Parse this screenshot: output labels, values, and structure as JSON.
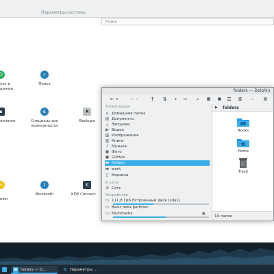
{
  "settings": {
    "title": "Параметры системы",
    "search_placeholder": "Поиск",
    "modules": [
      {
        "label": "уск и\nшение",
        "icon": "power-icon",
        "color": "#27ae60"
      },
      {
        "label": "Поиск",
        "icon": "search-icon",
        "color": "#2980b9"
      },
      {
        "label": "ожения",
        "icon": "applications-icon",
        "color": "#2c3e50"
      },
      {
        "label": "Специальные\nвозможности",
        "icon": "accessibility-icon",
        "color": "#2980b9"
      },
      {
        "label": "Backups",
        "icon": "backups-icon",
        "color": "#7f8c8d"
      },
      {
        "label": "\nием",
        "icon": "power-management-icon",
        "color": "#f1c40f"
      },
      {
        "label": "Bluetooth",
        "icon": "bluetooth-icon",
        "color": "#2980b9"
      },
      {
        "label": "KDE Connect",
        "icon": "kde-connect-icon",
        "color": "#2c3e50"
      }
    ]
  },
  "dolphin": {
    "title": "folders — Dolphin",
    "sections": {
      "places": "Точки входа",
      "network": "В сети",
      "devices": "Устройства"
    },
    "places": [
      {
        "label": "Домашняя папка",
        "icon": "home-icon"
      },
      {
        "label": "Документы",
        "icon": "documents-icon"
      },
      {
        "label": "Загрузки",
        "icon": "downloads-icon"
      },
      {
        "label": "Видео",
        "icon": "video-icon"
      },
      {
        "label": "Изображения",
        "icon": "pictures-icon"
      },
      {
        "label": "Книги",
        "icon": "books-icon"
      },
      {
        "label": "Музыка",
        "icon": "music-icon"
      },
      {
        "label": "Фото",
        "icon": "photo-icon"
      },
      {
        "label": "GitHub",
        "icon": "github-icon"
      },
      {
        "label": "folders",
        "icon": "folder-icon",
        "selected": true
      },
      {
        "label": "work",
        "icon": "folder-icon"
      },
      {
        "label": "Корзина",
        "icon": "trash-icon"
      }
    ],
    "network": [
      {
        "label": "Сеть",
        "icon": "network-icon"
      }
    ],
    "devices": [
      {
        "label": "111,8 ГиБ Встроенный диск (sda1)",
        "icon": "disk-icon",
        "usage": 0.42
      },
      {
        "label": "Basic data partition",
        "icon": "disk-icon"
      },
      {
        "label": "Multimedia",
        "icon": "disk-icon",
        "usage": 0.55
      }
    ],
    "breadcrumb": "folders",
    "items": [
      {
        "label": "Books",
        "icon": "folder-books-icon"
      },
      {
        "label": "Home",
        "icon": "folder-home-icon"
      },
      {
        "label": "Trash",
        "icon": "trash-full-icon"
      }
    ],
    "status": "10 папок"
  },
  "taskbar": {
    "tasks": [
      {
        "label": "folders — D...",
        "icon": "dolphin-icon",
        "active": true
      },
      {
        "label": "Параметры ...",
        "icon": "settings-icon",
        "active": false
      }
    ]
  },
  "colors": {
    "accent": "#3daee9",
    "panel": "#1c2a35",
    "window_bg": "#eff0f1"
  }
}
